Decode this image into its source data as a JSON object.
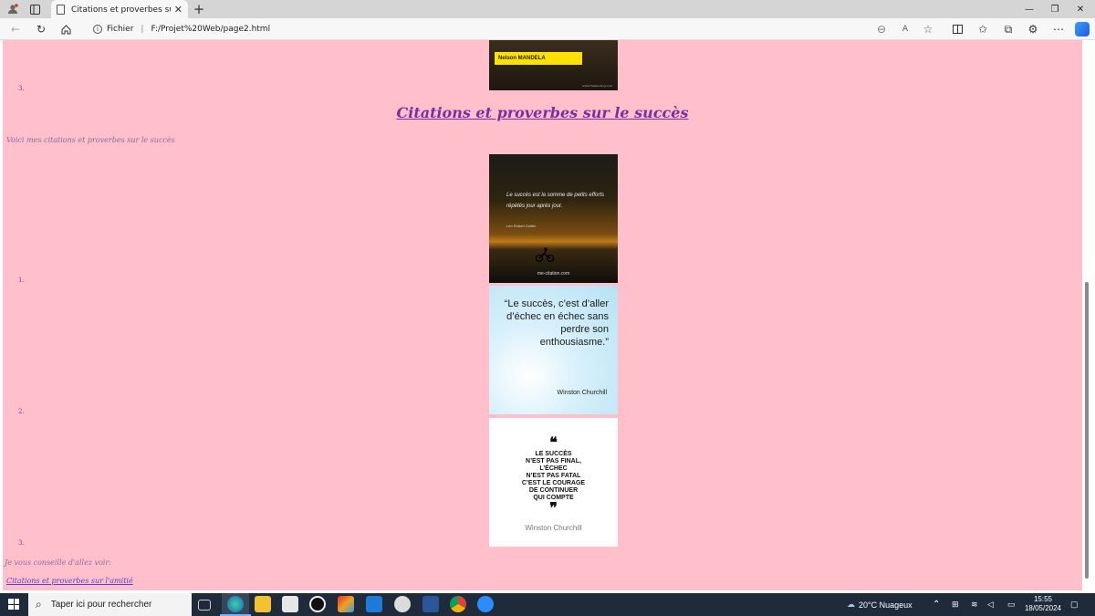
{
  "browser": {
    "tab_title": "Citations et proverbes sur le succès",
    "tab_close": "✕",
    "new_tab": "+",
    "window_minimize": "—",
    "window_restore": "❐",
    "window_close": "✕",
    "address_label": "Fichier",
    "address_url": "F:/Projet%20Web/page2.html"
  },
  "page": {
    "top_image": {
      "name_label": "Nelson MANDELA",
      "site": "www.rtssite-blog.com"
    },
    "list_markers": [
      "3.",
      "1.",
      "2.",
      "3."
    ],
    "title": "Citations et proverbes sur le succès",
    "intro": "Voici mes citations et proverbes sur le succès",
    "images": [
      {
        "quote": "Le succès est la somme de petits efforts répétés jour après jour.",
        "author": "Leo Robert Collier",
        "site": "me-citation.com"
      },
      {
        "quote": "“Le succès, c’est d’aller d’échec en échec sans perdre son enthousiasme.”",
        "author": "Winston Churchill"
      },
      {
        "open_quote": "❝",
        "quote": "LE SUCCÈS\nN’EST PAS FINAL,\nL’ÉCHEC\nN’EST PAS FATAL\nC’EST LE COURAGE\nDE CONTINUER\nQUI COMPTE",
        "close_quote": "❞",
        "author": "Winston Churchill"
      }
    ],
    "outro": "Je vous conseille d'allez voir:",
    "link": "Citations et proverbes sur l'amitié"
  },
  "taskbar": {
    "search_placeholder": "Taper ici pour rechercher",
    "weather": "20°C  Nuageux",
    "time": "15:55",
    "date": "18/05/2024"
  },
  "colors": {
    "page_background": "#ffc0cb",
    "title": "#7a2fa0",
    "link": "#5a3fd0",
    "taskbar": "#1f2a3b"
  }
}
